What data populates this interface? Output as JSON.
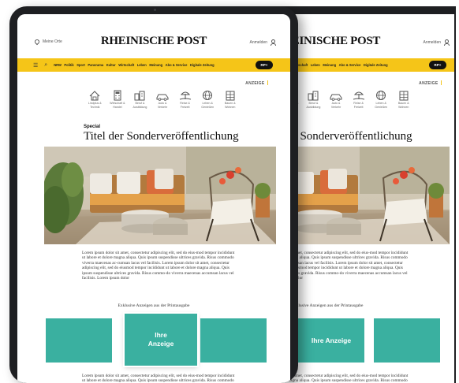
{
  "header": {
    "location": "Meine Orte",
    "logo": "RHEINISCHE POST",
    "login": "Anmelden",
    "nav_items": [
      "NRW",
      "Politik",
      "Sport",
      "Panorama",
      "Kultur",
      "Wirtschaft",
      "Leben",
      "Meinung",
      "Abo & Service",
      "Digitale Zeitung"
    ],
    "rp_plus": "RP+"
  },
  "anzeige": "ANZEIGE",
  "categories": [
    {
      "icon": "house-icon",
      "label": "Lindplus &\nTechnik"
    },
    {
      "icon": "calculator-icon",
      "label": "Wirtschaft &\nHandel"
    },
    {
      "icon": "buildings-icon",
      "label": "Beruf &\nAusbildung"
    },
    {
      "icon": "car-icon",
      "label": "Auto &\nVerkehr"
    },
    {
      "icon": "beach-icon",
      "label": "Reise &\nFreizeit"
    },
    {
      "icon": "globe-icon",
      "label": "Leben &\nGenießen"
    },
    {
      "icon": "building-icon",
      "label": "Bauen &\nWohnen"
    }
  ],
  "article": {
    "kicker": "Special",
    "title": "Titel der Sonderveröffentlichung",
    "body_1": "Lorem ipsum dolor sit amet, consectetur adipiscing elit, sed do eius-mod tempor incididunt ut labore et dolore magna aliqua. Quis ipsum suspendisse ultrices gravida. Risus commodo viverra maecenas ac-cumsan lacus vel facilisis. Lorem ipsum dolor sit amet, consectetur adipiscing elit, sed do eiusmod tempor incididunt ut labore et dolore magna aliqua. Quis ipsum suspendisse ultrices gravida. Risus commo-do viverra maecenas accumsan lacus vel facilisis. Lorem ipsum dolor",
    "exclusive": "Exklusive Anzeigen aus der Printausgabe",
    "ad_label": "Ihre\nAnzeige",
    "ad_label_back": "Ihre Anzeige",
    "body_2": "Lorem ipsum dolor sit amet, consectetur adipiscing elit, sed do eius-mod tempor incididunt ut labore et dolore magna aliqua. Quis ipsum suspendisse ultrices gravida. Risus commodo viverra maecenas ac-"
  },
  "colors": {
    "nav_yellow": "#f5c518",
    "ad_teal": "#3ab0a0",
    "bezel": "#1e1f22"
  }
}
